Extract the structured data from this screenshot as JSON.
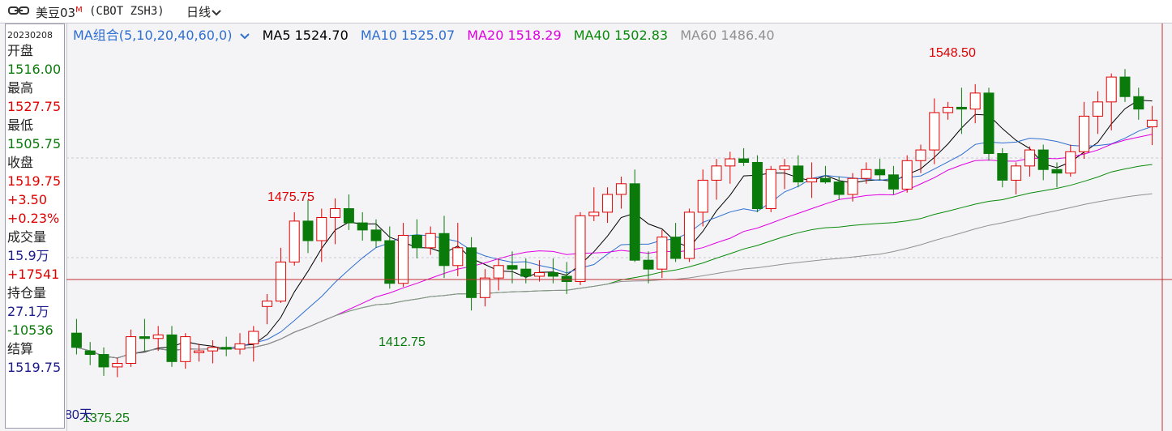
{
  "header": {
    "symbol": "美豆03",
    "symbol_badge": "M",
    "code": "(CBOT ZSH3)",
    "period": "日线"
  },
  "sidebar": {
    "date": "20230208",
    "open_label": "开盘",
    "open_value": "1516.00",
    "high_label": "最高",
    "high_value": "1527.75",
    "low_label": "最低",
    "low_value": "1505.75",
    "close_label": "收盘",
    "close_value": "1519.75",
    "change": "+3.50",
    "change_pct": "+0.23%",
    "volume_label": "成交量",
    "volume_value": "15.9万",
    "volume_change": "+17541",
    "oi_label": "持仓量",
    "oi_value": "27.1万",
    "oi_change": "-10536",
    "settle_label": "结算",
    "settle_value": "1519.75"
  },
  "legend": {
    "combo": "MA组合(5,10,20,40,60,0)",
    "ma5": "MA5 1524.70",
    "ma10": "MA10 1525.07",
    "ma20": "MA20 1518.29",
    "ma40": "MA40 1502.83",
    "ma60": "MA60 1486.40"
  },
  "colors": {
    "up": "#e00000",
    "down": "#0a7a0a",
    "ma5": "#000000",
    "ma10": "#2f6fd0",
    "ma20": "#e000e0",
    "ma40": "#0a8a0a",
    "ma60": "#909090"
  },
  "chart_data": {
    "type": "candlestick",
    "ylim": [
      1360,
      1565
    ],
    "bars": 80,
    "period_label": "80天",
    "annotations": {
      "high": "1548.50",
      "low": "1375.25",
      "local_high": "1475.75",
      "local_low": "1412.75"
    },
    "series": [
      {
        "name": "K",
        "ohlc": [
          [
            1400,
            1408,
            1388,
            1392
          ],
          [
            1390,
            1395,
            1382,
            1388
          ],
          [
            1388,
            1392,
            1376,
            1381
          ],
          [
            1381,
            1386,
            1375.25,
            1383
          ],
          [
            1383,
            1402,
            1381,
            1398
          ],
          [
            1398,
            1408,
            1390,
            1397
          ],
          [
            1397,
            1404,
            1390,
            1399
          ],
          [
            1399,
            1404,
            1381,
            1384
          ],
          [
            1384,
            1400,
            1380,
            1398
          ],
          [
            1389,
            1394,
            1384,
            1390
          ],
          [
            1390,
            1396,
            1383,
            1392
          ],
          [
            1392,
            1398,
            1387,
            1391
          ],
          [
            1391,
            1400,
            1388,
            1394
          ],
          [
            1394,
            1404,
            1384,
            1401
          ],
          [
            1415,
            1422,
            1405,
            1418
          ],
          [
            1418,
            1448,
            1417,
            1440
          ],
          [
            1440,
            1468,
            1438,
            1463
          ],
          [
            1463,
            1475,
            1445,
            1452
          ],
          [
            1452,
            1470,
            1440,
            1465
          ],
          [
            1465,
            1475.75,
            1450,
            1470
          ],
          [
            1470,
            1478,
            1458,
            1462
          ],
          [
            1462,
            1468,
            1452,
            1458
          ],
          [
            1458,
            1464,
            1448,
            1452
          ],
          [
            1452,
            1460,
            1425,
            1428
          ],
          [
            1428,
            1462,
            1426,
            1455
          ],
          [
            1455,
            1464,
            1442,
            1448
          ],
          [
            1448,
            1460,
            1444,
            1456
          ],
          [
            1456,
            1466,
            1431,
            1438
          ],
          [
            1438,
            1462,
            1432,
            1448
          ],
          [
            1448,
            1454,
            1412.75,
            1420
          ],
          [
            1420,
            1436,
            1415,
            1431
          ],
          [
            1431,
            1442,
            1424,
            1438
          ],
          [
            1438,
            1446,
            1428,
            1436
          ],
          [
            1436,
            1442,
            1428,
            1432
          ],
          [
            1432,
            1441,
            1429,
            1434
          ],
          [
            1434,
            1442,
            1428,
            1432
          ],
          [
            1432,
            1440,
            1422,
            1429
          ],
          [
            1429,
            1468,
            1427,
            1466
          ],
          [
            1466,
            1482,
            1463,
            1468
          ],
          [
            1468,
            1482,
            1462,
            1478
          ],
          [
            1478,
            1488,
            1470,
            1484
          ],
          [
            1484,
            1492,
            1440,
            1441
          ],
          [
            1441,
            1446,
            1428,
            1436
          ],
          [
            1436,
            1458,
            1431,
            1454
          ],
          [
            1454,
            1462,
            1440,
            1442
          ],
          [
            1442,
            1470,
            1440,
            1468
          ],
          [
            1468,
            1492,
            1460,
            1486
          ],
          [
            1486,
            1498,
            1475,
            1494
          ],
          [
            1494,
            1502,
            1484,
            1498
          ],
          [
            1498,
            1504,
            1494,
            1496
          ],
          [
            1496,
            1500,
            1468,
            1470
          ],
          [
            1470,
            1494,
            1468,
            1492
          ],
          [
            1492,
            1498,
            1481,
            1494
          ],
          [
            1494,
            1500,
            1482,
            1485
          ],
          [
            1485,
            1496,
            1476,
            1487
          ],
          [
            1487,
            1494,
            1484,
            1485
          ],
          [
            1485,
            1488,
            1475,
            1478
          ],
          [
            1478,
            1490,
            1474,
            1487
          ],
          [
            1487,
            1496,
            1484,
            1492
          ],
          [
            1492,
            1498,
            1486,
            1489
          ],
          [
            1489,
            1494,
            1478,
            1481
          ],
          [
            1481,
            1500,
            1479,
            1497
          ],
          [
            1497,
            1506,
            1490,
            1503
          ],
          [
            1503,
            1532,
            1495,
            1524
          ],
          [
            1524,
            1530,
            1520,
            1527
          ],
          [
            1527,
            1538,
            1512,
            1526
          ],
          [
            1526,
            1540,
            1518,
            1535
          ],
          [
            1535,
            1538,
            1497,
            1501
          ],
          [
            1501,
            1504,
            1482,
            1486
          ],
          [
            1486,
            1496,
            1478,
            1494
          ],
          [
            1494,
            1505,
            1488,
            1503
          ],
          [
            1503,
            1506,
            1486,
            1492
          ],
          [
            1492,
            1496,
            1482,
            1490
          ],
          [
            1490,
            1506,
            1488,
            1502
          ],
          [
            1502,
            1530,
            1498,
            1522
          ],
          [
            1522,
            1536,
            1512,
            1530
          ],
          [
            1530,
            1546,
            1514,
            1544
          ],
          [
            1544,
            1548.5,
            1530,
            1533
          ],
          [
            1533,
            1538,
            1520,
            1526
          ],
          [
            1516,
            1527.75,
            1505.75,
            1519.75
          ]
        ]
      }
    ]
  }
}
